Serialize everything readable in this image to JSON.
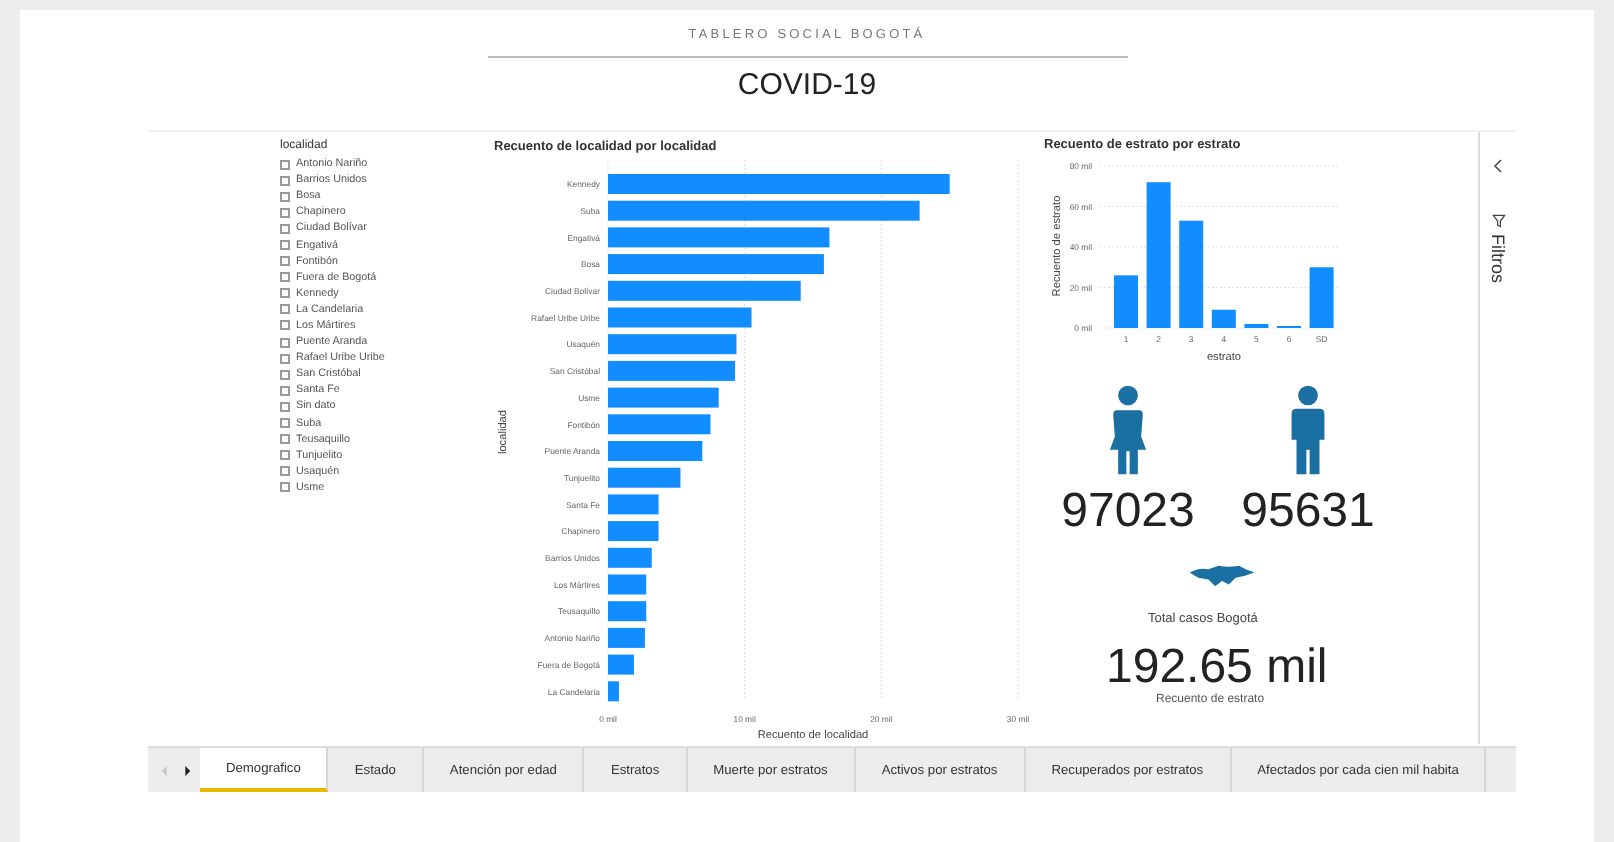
{
  "header": {
    "subtitle": "TABLERO SOCIAL BOGOTÁ",
    "title": "COVID-19"
  },
  "slicer": {
    "title": "localidad",
    "items": [
      {
        "label": "Antonio Nariño",
        "checked": false
      },
      {
        "label": "Barrios Unidos",
        "checked": false
      },
      {
        "label": "Bosa",
        "checked": false
      },
      {
        "label": "Chapinero",
        "checked": false
      },
      {
        "label": "Ciudad Bolívar",
        "checked": false
      },
      {
        "label": "Engativá",
        "checked": false
      },
      {
        "label": "Fontibón",
        "checked": false
      },
      {
        "label": "Fuera de Bogotá",
        "checked": false
      },
      {
        "label": "Kennedy",
        "checked": false
      },
      {
        "label": "La Candelaria",
        "checked": false
      },
      {
        "label": "Los Mártires",
        "checked": false
      },
      {
        "label": "Puente Aranda",
        "checked": false
      },
      {
        "label": "Rafael Uribe Uribe",
        "checked": false
      },
      {
        "label": "San Cristóbal",
        "checked": false
      },
      {
        "label": "Santa Fe",
        "checked": false
      },
      {
        "label": "Sin dato",
        "checked": false
      },
      {
        "label": "Suba",
        "checked": false
      },
      {
        "label": "Teusaquillo",
        "checked": false
      },
      {
        "label": "Tunjuelito",
        "checked": false
      },
      {
        "label": "Usaquén",
        "checked": false
      },
      {
        "label": "Usme",
        "checked": false
      }
    ]
  },
  "bar_chart": {
    "title": "Recuento de localidad por localidad",
    "chart_data": {
      "type": "bar",
      "orientation": "horizontal",
      "xlabel": "Recuento de localidad",
      "ylabel": "localidad",
      "categories": [
        "Kennedy",
        "Suba",
        "Engativá",
        "Bosa",
        "Ciudad Bolívar",
        "Rafael Uribe Uribe",
        "Usaquén",
        "San Cristóbal",
        "Usme",
        "Fontibón",
        "Puente Aranda",
        "Tunjuelito",
        "Santa Fe",
        "Chapinero",
        "Barrios Unidos",
        "Los Mártires",
        "Teusaquillo",
        "Antonio Nariño",
        "Fuera de Bogotá",
        "La Candelaria"
      ],
      "series": [
        {
          "color": "#118dff",
          "values": [
            25,
            22.8,
            16.2,
            15.8,
            14.1,
            10.5,
            9.4,
            9.3,
            8.1,
            7.5,
            6.9,
            5.3,
            3.7,
            3.7,
            3.2,
            2.8,
            2.8,
            2.7,
            1.9,
            0.8
          ]
        }
      ],
      "grid": true,
      "xlim": [
        0,
        30
      ],
      "xticks": [
        {
          "value": 0,
          "label": "0 mil"
        },
        {
          "value": 10,
          "label": "10 mil"
        },
        {
          "value": 20,
          "label": "20 mil"
        },
        {
          "value": 30,
          "label": "30 mil"
        }
      ]
    }
  },
  "column_chart": {
    "title": "Recuento de estrato por estrato",
    "chart_data": {
      "type": "bar",
      "orientation": "vertical",
      "xlabel": "estrato",
      "ylabel": "Recuento de estrato",
      "categories": [
        "1",
        "2",
        "3",
        "4",
        "5",
        "6",
        "SD"
      ],
      "series": [
        {
          "color": "#118dff",
          "values": [
            26,
            72,
            53,
            9,
            2,
            1,
            30
          ]
        }
      ],
      "grid": true,
      "ylim": [
        0,
        80
      ],
      "yticks": [
        {
          "value": 0,
          "label": "0 mil"
        },
        {
          "value": 20,
          "label": "20 mil"
        },
        {
          "value": 40,
          "label": "40 mil"
        },
        {
          "value": 60,
          "label": "60 mil"
        },
        {
          "value": 80,
          "label": "80 mil"
        }
      ]
    }
  },
  "gender_cards": [
    {
      "kind": "female",
      "value": "97023"
    },
    {
      "kind": "male",
      "value": "95631"
    }
  ],
  "total": {
    "label": "Total casos Bogotá",
    "value": "192.65 mil",
    "caption": "Recuento de estrato"
  },
  "filters_pane": {
    "label": "Filtros"
  },
  "page_tabs": [
    {
      "label": "Demografico",
      "selected": true
    },
    {
      "label": "Estado",
      "selected": false
    },
    {
      "label": "Atención por edad",
      "selected": false
    },
    {
      "label": "Estratos",
      "selected": false
    },
    {
      "label": "Muerte por estratos",
      "selected": false
    },
    {
      "label": "Activos por estratos",
      "selected": false
    },
    {
      "label": "Recuperados por estratos",
      "selected": false
    },
    {
      "label": "Afectados por cada cien mil habita",
      "selected": false
    }
  ]
}
